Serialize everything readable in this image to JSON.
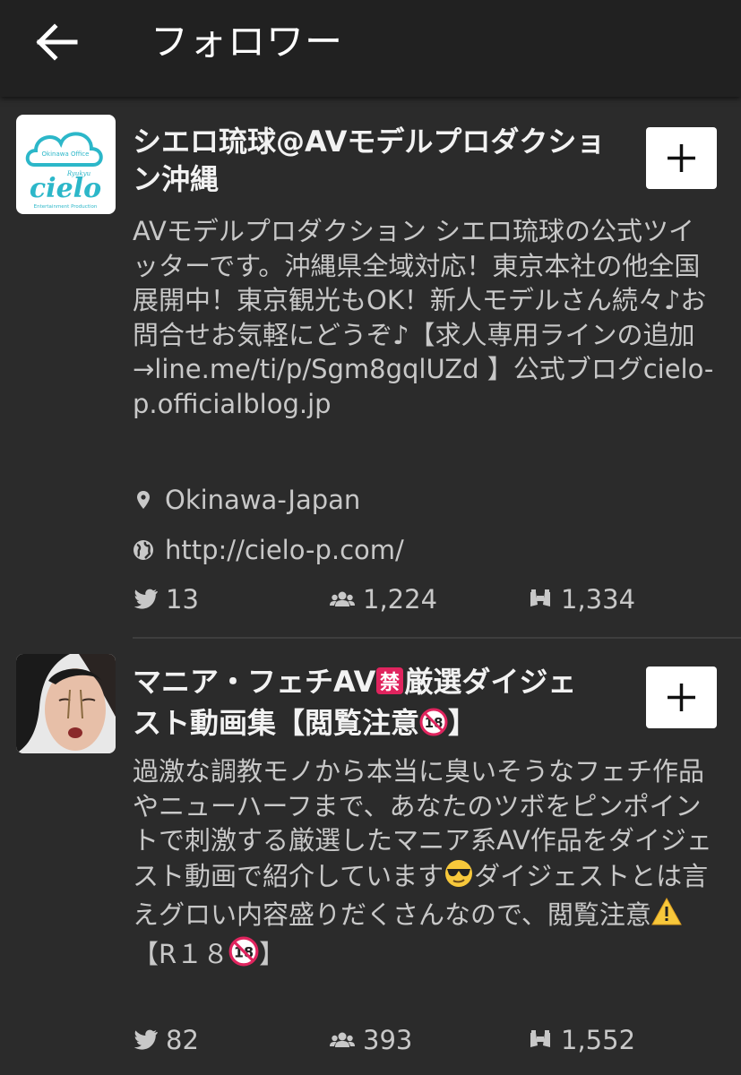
{
  "header": {
    "title": "フォロワー",
    "back_icon": "arrow-left-icon"
  },
  "colors": {
    "background": "#2b2b2b",
    "topbar": "#212121",
    "text_primary": "#f2f2f2",
    "text_secondary": "#c8c8c8",
    "follow_button": "#ffffff"
  },
  "users": [
    {
      "name_part1": "シエロ琉球@AVモデルプロダクショ",
      "name_part2": "ン沖縄",
      "avatar": {
        "logo_top": "Okinawa Office",
        "logo_script": "Ryukyu",
        "logo_word": "cielo",
        "logo_bottom": "Entertainment Production"
      },
      "bio": "AVモデルプロダクション シエロ琉球の公式ツイッターです。沖縄県全域対応！東京本社の他全国展開中！東京観光もOK！新人モデルさん続々♪お問合せお気軽にどうぞ♪【求人専用ラインの追加→line.me/ti/p/Sgm8gqlUZd 】公式ブログcielo-p.officialblog.jp",
      "location": "Okinawa-Japan",
      "url": "http://cielo-p.com/",
      "tweets": "13",
      "followers": "1,224",
      "following": "1,334"
    },
    {
      "name_part1": "マニア・フェチAV",
      "name_part2": "厳選ダイジェ",
      "name_part3": "スト動画集【閲覧注意",
      "name_part4": "】",
      "name_badge_prohibited": "禁",
      "name_badge_r18": "18",
      "bio_part1": "過激な調教モノから本当に臭いそうなフェチ作品やニューハーフまで、あなたのツボをピンポイントで刺激する厳選したマニア系AV作品をダイジェスト動画で紹介しています",
      "bio_part2": "ダイジェストとは言えグロい内容盛りだくさんなので、閲覧注意",
      "bio_part3": "【R１８",
      "bio_part4": "】",
      "bio_badge_r18": "18",
      "tweets": "82",
      "followers": "393",
      "following": "1,552"
    }
  ],
  "icons": {
    "tweets": "twitter-bird-icon",
    "followers": "followers-icon",
    "following": "binoculars-icon",
    "location": "map-pin-icon",
    "url": "globe-icon",
    "follow": "plus-icon"
  }
}
